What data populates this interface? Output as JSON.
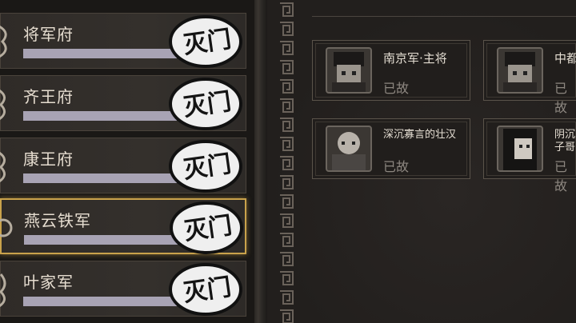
{
  "factions": [
    {
      "name": "将军府",
      "seal": "灭门",
      "progress": 0.93,
      "selected": false
    },
    {
      "name": "齐王府",
      "seal": "灭门",
      "progress": 0.93,
      "selected": false
    },
    {
      "name": "康王府",
      "seal": "灭门",
      "progress": 0.93,
      "selected": false
    },
    {
      "name": "燕云铁军",
      "seal": "灭门",
      "progress": 0.93,
      "selected": true
    },
    {
      "name": "叶家军",
      "seal": "灭门",
      "progress": 0.93,
      "selected": false
    }
  ],
  "characters": [
    {
      "name": "南京军·主将",
      "status": "已故"
    },
    {
      "name": "中都",
      "status": "已故"
    },
    {
      "name": "深沉寡言的壮汉",
      "status": "已故"
    },
    {
      "name": "阴沉子哥",
      "status": "已故"
    }
  ],
  "colors": {
    "selected_border": "#c9a24b",
    "bar_fill": "#a8a3b4",
    "text": "#e6ddd0",
    "status": "#8d8780"
  }
}
